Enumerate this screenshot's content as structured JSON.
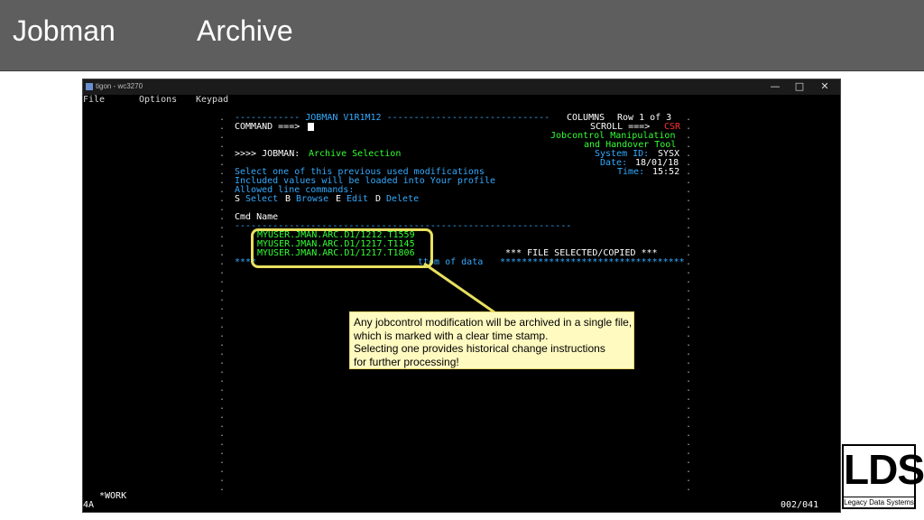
{
  "slide": {
    "title": "Jobman",
    "subtitle": "Archive"
  },
  "window": {
    "title": "tigon - wc3270"
  },
  "menu": [
    "File",
    "Options",
    "Keypad"
  ],
  "screen": {
    "header_line": "------------ JOBMAN V1R1M12 ------------------------------",
    "columns_label": "COLUMNS",
    "row_label": "Row 1 of 3",
    "command_label": "COMMAND ===>",
    "scroll_label": "SCROLL ===>",
    "scroll_value": "CSR",
    "tool_name_1": "Jobcontrol Manipulation",
    "tool_name_2": "and Handover Tool",
    "system_id_label": "System ID:",
    "system_id": "SYSX",
    "date_label": "Date:",
    "date": "18/01/18",
    "time_label": "Time:",
    "time": "15:52",
    "prompt_prefix": ">>>> JOBMAN:",
    "prompt_title": "Archive Selection",
    "instr_1": "Select one of this previous used modifications",
    "instr_2": "Included values will be loaded into Your profile",
    "instr_3": "Allowed line commands:",
    "cmd_s": "S",
    "cmd_s_label": "Select",
    "cmd_b": "B",
    "cmd_b_label": "Browse",
    "cmd_e": "E",
    "cmd_e_label": "Edit",
    "cmd_d": "D",
    "cmd_d_label": "Delete",
    "col_header": "Cmd Name",
    "col_rule": "--------------------------------------------------------------",
    "files": [
      "MYUSER.JMAN.ARC.D1/1212.T1559",
      "MYUSER.JMAN.ARC.D1/1217.T1145",
      "MYUSER.JMAN.ARC.D1/1217.T1806"
    ],
    "status_msg": "*** FILE SELECTED/COPIED ***",
    "bottom_left": "****",
    "bottom_mid": "ttom of data",
    "bottom_right": "**********************************",
    "bottom_status": "*WORK",
    "bottom_mode": "4A",
    "cursor_pos": "002/041"
  },
  "callout": {
    "lines": [
      "Any jobcontrol modification will be archived in a single file,",
      "which is marked with a clear time stamp.",
      "Selecting one provides historical change instructions",
      "for further processing!"
    ]
  },
  "logo": {
    "text": "LDS",
    "subtitle": "Legacy Data Systems"
  },
  "colors": {
    "header_bg": "#5e5e5e",
    "terminal_bg": "#000000",
    "green": "#33ff33",
    "cyan": "#33aaff",
    "red": "#ff3030",
    "highlight": "#e8e05e",
    "callout_bg": "#fffac0"
  }
}
